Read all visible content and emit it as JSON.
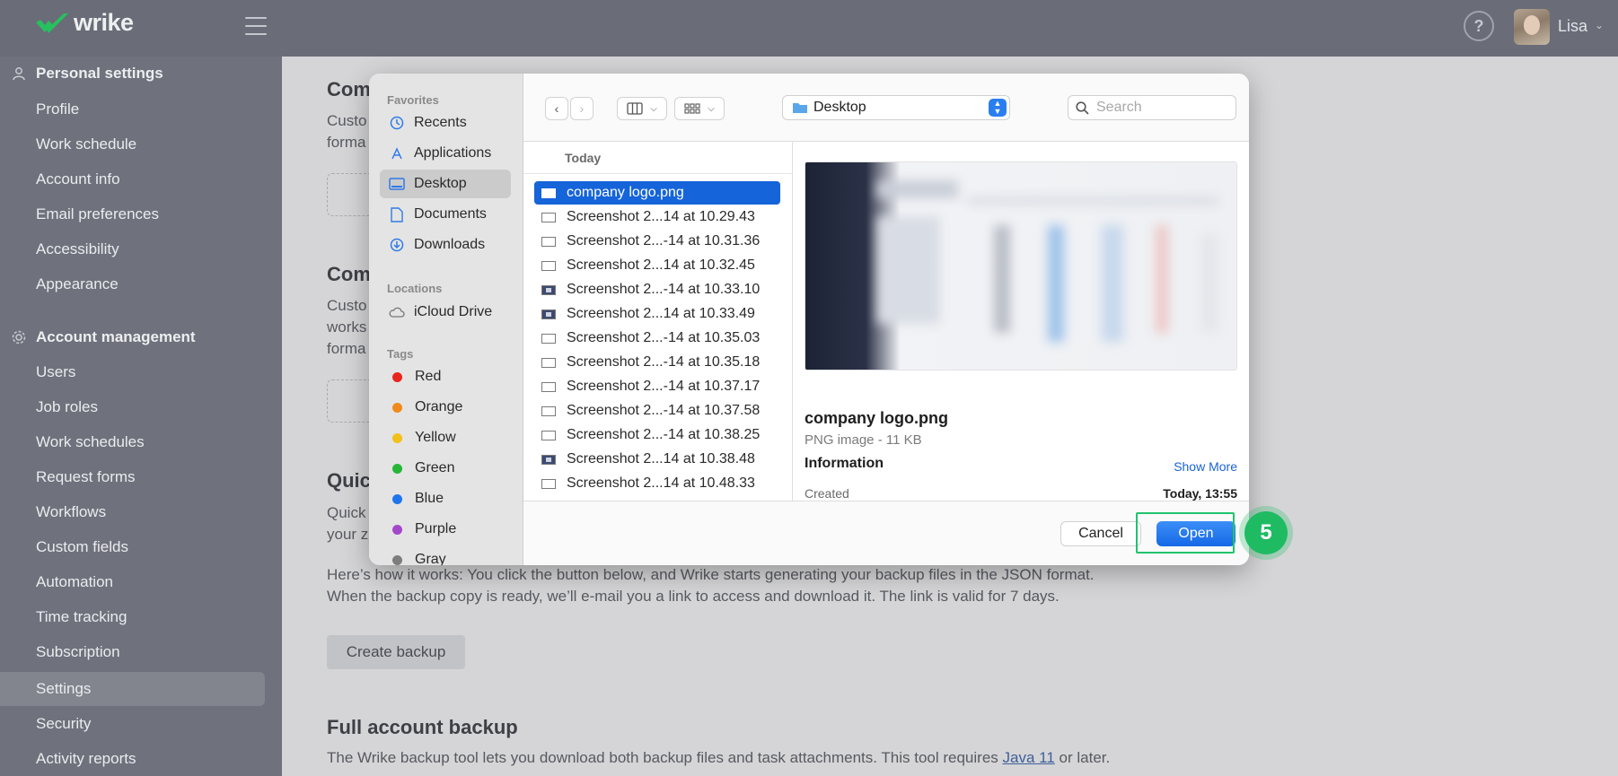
{
  "app": {
    "logo_text": "wrike"
  },
  "header": {
    "help_label": "?",
    "user_name": "Lisa"
  },
  "sidebar": {
    "personal": {
      "title": "Personal settings",
      "items": [
        "Profile",
        "Work schedule",
        "Account info",
        "Email preferences",
        "Accessibility",
        "Appearance"
      ]
    },
    "account": {
      "title": "Account management",
      "items": [
        "Users",
        "Job roles",
        "Work schedules",
        "Request forms",
        "Workflows",
        "Custom fields",
        "Automation",
        "Time tracking",
        "Subscription",
        "Settings",
        "Security",
        "Activity reports"
      ],
      "active": "Settings"
    }
  },
  "main": {
    "frag1_heading": "Com",
    "frag1_text1": "Custo",
    "frag1_text2": "forma",
    "frag2_heading": "Com",
    "frag2_text1": "Custo",
    "frag2_text2": "works",
    "frag2_text3": "forma",
    "frag3_heading": "Quic",
    "frag3_text1": "Quick",
    "frag3_text2": "your z",
    "backup_text1": "Here’s how it works: You click the button below, and Wrike starts generating your backup files in the JSON format.",
    "backup_text2": "When the backup copy is ready, we’ll e-mail you a link to access and download it. The link is valid for 7 days.",
    "create_backup": "Create backup",
    "full_heading": "Full account backup",
    "full_text_pre": "The Wrike backup tool lets you download both backup files and task attachments. This tool requires ",
    "full_text_link": "Java 11",
    "full_text_post": " or later."
  },
  "dialog": {
    "favorites_title": "Favorites",
    "favorites": [
      "Recents",
      "Applications",
      "Desktop",
      "Documents",
      "Downloads"
    ],
    "selected_favorite": "Desktop",
    "locations_title": "Locations",
    "locations": [
      "iCloud Drive"
    ],
    "tags_title": "Tags",
    "tags": [
      {
        "name": "Red",
        "color": "#e8261f"
      },
      {
        "name": "Orange",
        "color": "#f08a1d"
      },
      {
        "name": "Yellow",
        "color": "#f2c01a"
      },
      {
        "name": "Green",
        "color": "#27b637"
      },
      {
        "name": "Blue",
        "color": "#1f76ec"
      },
      {
        "name": "Purple",
        "color": "#a348c9"
      },
      {
        "name": "Gray",
        "color": "#7d7d7d"
      }
    ],
    "folder": "Desktop",
    "search_placeholder": "Search",
    "column_header": "Today",
    "files": [
      "company logo.png",
      "Screenshot 2...14 at 10.29.43",
      "Screenshot 2...-14 at 10.31.36",
      "Screenshot 2...14 at 10.32.45",
      "Screenshot 2...-14 at 10.33.10",
      "Screenshot 2...14 at 10.33.49",
      "Screenshot 2...-14 at 10.35.03",
      "Screenshot 2...-14 at 10.35.18",
      "Screenshot 2...-14 at 10.37.17",
      "Screenshot 2...-14 at 10.37.58",
      "Screenshot 2...-14 at 10.38.25",
      "Screenshot 2...14 at 10.38.48",
      "Screenshot 2...14 at 10.48.33"
    ],
    "selected_file": "company logo.png",
    "preview": {
      "name": "company logo.png",
      "type": "PNG image - 11 KB",
      "info_title": "Information",
      "show_more": "Show More",
      "created_label": "Created",
      "created_value": "Today, 13:55"
    },
    "cancel_label": "Cancel",
    "open_label": "Open"
  },
  "annotation": {
    "step": "5"
  }
}
